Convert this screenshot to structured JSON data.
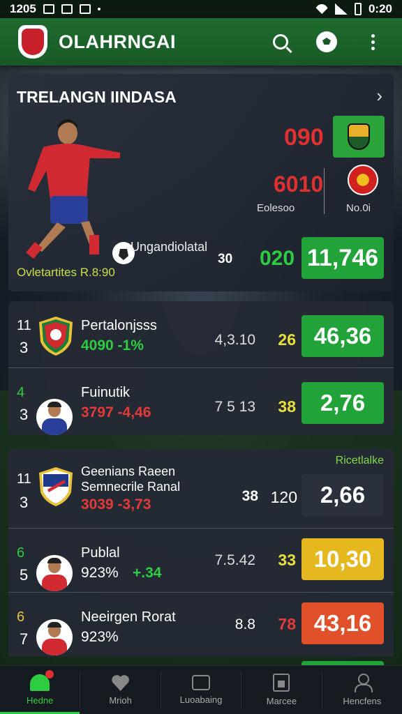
{
  "statusbar": {
    "left_text": "1205",
    "time": "0:20"
  },
  "app": {
    "title": "OLAHRNGAI"
  },
  "hero": {
    "title": "TRELANGN IINDASA",
    "player_name": "Ungandiolatal",
    "league": "Ovletartites R.8:90",
    "odd_top": "090",
    "odd_second": "6010",
    "label_left": "Eolesoo",
    "label_right": "No.0i",
    "small_value": "30",
    "mid_value": "020",
    "main_odd": "11,746"
  },
  "group1": {
    "rows": [
      {
        "num_a": "11",
        "num_b": "3",
        "name": "Pertalonjsss",
        "sub": "4090 -1%",
        "stat1": "4,3.10",
        "stat2": "26",
        "odd": "46,36"
      },
      {
        "num_a": "4",
        "num_b": "3",
        "name": "Fuinutik",
        "sub": "3797 -4,46",
        "stat1": "7 5 13",
        "stat2": "38",
        "odd": "2,76"
      }
    ]
  },
  "group2": {
    "live_tag": "Ricetlalke",
    "rows": [
      {
        "num_a": "11",
        "num_b": "3",
        "name": "Geenians Raeen",
        "name2": "Semnecrile Ranal",
        "sub": "3039 -3,73",
        "stat1": "38",
        "stat2": "120",
        "odd": "2,66"
      },
      {
        "num_a": "6",
        "num_b": "5",
        "name": "Publal",
        "sub": "923%",
        "sub2": "+.34",
        "stat1": "7.5.42",
        "stat2": "33",
        "odd": "10,30"
      },
      {
        "num_a": "6",
        "num_b": "7",
        "name": "Neeirgen Rorat",
        "sub": "923%",
        "stat1": "8.8",
        "stat2": "78",
        "odd": "43,16"
      }
    ]
  },
  "nav": {
    "items": [
      {
        "label": "Hedne"
      },
      {
        "label": "Mrioh"
      },
      {
        "label": "Luoabaing"
      },
      {
        "label": "Marcee"
      },
      {
        "label": "Hencfens"
      }
    ]
  }
}
